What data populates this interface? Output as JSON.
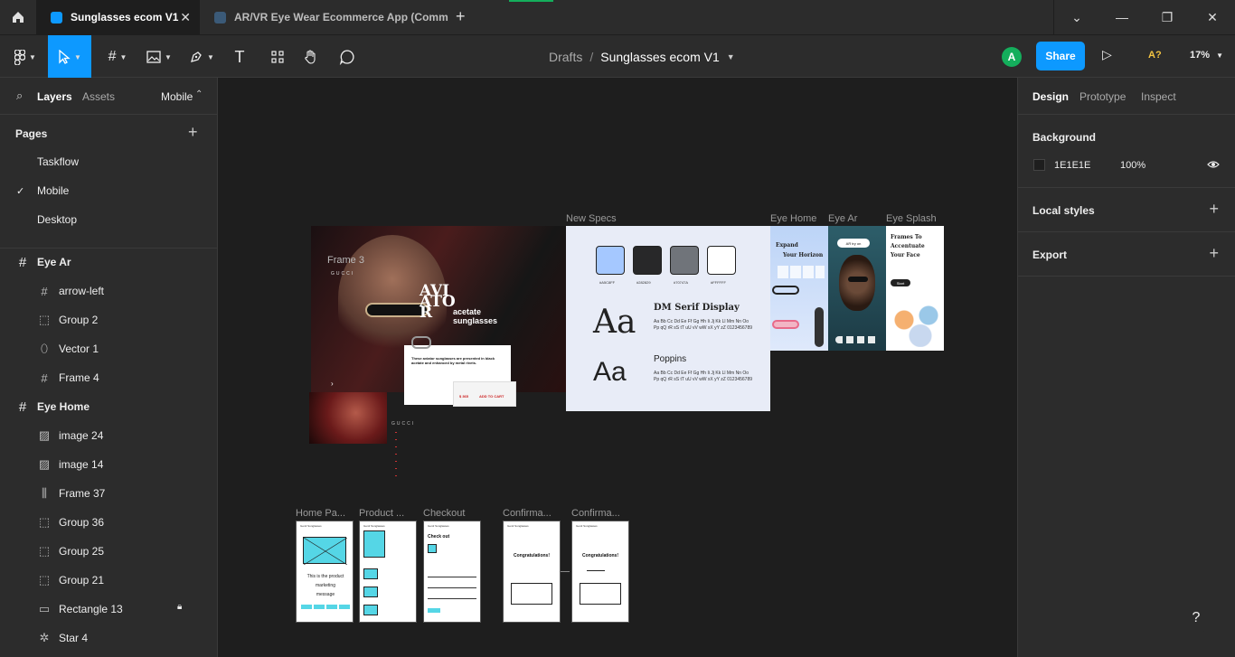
{
  "tabs": {
    "active": {
      "title": "Sunglasses ecom V1"
    },
    "second": {
      "title": "AR/VR Eye Wear Ecommerce App (Comm"
    }
  },
  "window": {
    "minimize": "—",
    "maximize": "❐",
    "close": "✕",
    "menu": "⌄"
  },
  "toolbar": {
    "breadcrumb_parent": "Drafts",
    "breadcrumb_sep": "/",
    "file_name": "Sunglasses ecom V1",
    "avatar_initial": "A",
    "share_label": "Share",
    "a11y_label": "A?",
    "zoom": "17%"
  },
  "left_panel": {
    "tab_layers": "Layers",
    "tab_assets": "Assets",
    "page_selector": "Mobile",
    "pages_title": "Pages",
    "pages": [
      "Taskflow",
      "Mobile",
      "Desktop"
    ],
    "selected_page": "Mobile",
    "layers": [
      {
        "name": "Eye Ar",
        "icon": "frame-icon",
        "level": 0
      },
      {
        "name": "arrow-left",
        "icon": "frame-icon",
        "level": 1
      },
      {
        "name": "Group 2",
        "icon": "group-icon",
        "level": 1
      },
      {
        "name": "Vector 1",
        "icon": "vector-icon",
        "level": 1
      },
      {
        "name": "Frame 4",
        "icon": "frame-icon",
        "level": 1
      },
      {
        "name": "Eye Home",
        "icon": "frame-icon",
        "level": 0
      },
      {
        "name": "image 24",
        "icon": "image-icon",
        "level": 1
      },
      {
        "name": "image 14",
        "icon": "image-icon",
        "level": 1
      },
      {
        "name": "Frame 37",
        "icon": "columns-icon",
        "level": 1
      },
      {
        "name": "Group 36",
        "icon": "group-icon",
        "level": 1
      },
      {
        "name": "Group 25",
        "icon": "group-icon",
        "level": 1
      },
      {
        "name": "Group 21",
        "icon": "group-icon",
        "level": 1
      },
      {
        "name": "Rectangle 13",
        "icon": "rectangle-icon",
        "level": 1,
        "locked": true
      },
      {
        "name": "Star 4",
        "icon": "star-icon",
        "level": 1
      }
    ]
  },
  "canvas": {
    "frame_titles": {
      "new_specs": "New Specs",
      "eye_home": "Eye Home",
      "eye_ar": "Eye Ar",
      "eye_splash": "Eye Splash",
      "frame3": "Frame 3",
      "home_page": "Home Pa...",
      "product": "Product ...",
      "checkout": "Checkout",
      "confirm1": "Confirma...",
      "confirm2": "Confirma..."
    },
    "hero": {
      "brand": "GUCCI",
      "title_line1": "AVI",
      "title_line2": "ATO",
      "title_line3": "R",
      "subtitle_line1": "acetate",
      "subtitle_line2": "sunglasses",
      "card_text": "These aviator sunglasses are presented in black acetate and enhanced by metal rivets.",
      "price": "$ 365",
      "cart": "ADD TO CART"
    },
    "specs": {
      "swatches": [
        "#A5C8FF",
        "#282829",
        "#70747A",
        "#FFFFFF"
      ],
      "swatch_labels": [
        "#A5C8FF",
        "#282829",
        "#70747A",
        "#FFFFFF"
      ],
      "font1_sample": "Aa",
      "font1_name": "DM Serif Display",
      "font1_glyphs": "Aa Bb Cc Dd Ee Ff Gg Hh Ii Jj Kk Ll Mm Nn Oo Pp qQ rR sS tT uU vV wW xX yY zZ 0123456789",
      "font2_sample": "Aa",
      "font2_name": "Poppins",
      "font2_glyphs": "Aa Bb Cc Dd Ee Ff Gg Hh Ii Jj Kk Ll Mm Nn Oo Pp qQ rR sS tT uU vV wW xX yY zZ 0123456789"
    },
    "eye_home": {
      "heading_line1": "Expand",
      "heading_line2": "Your Horizon"
    },
    "eye_ar": {
      "try_on": "AR try on"
    },
    "eye_splash": {
      "heading": "Frames To Accentuate Your Face",
      "start": "Start"
    },
    "wireframes": {
      "home_tagline_line1": "This is the product",
      "home_tagline_line2": "marketing",
      "home_tagline_line3": "message",
      "checkout_title": "Check out",
      "confirm_title": "Congratulations!",
      "brand": "Gen2 Sunglasses"
    }
  },
  "right_panel": {
    "tab_design": "Design",
    "tab_prototype": "Prototype",
    "tab_inspect": "Inspect",
    "background_title": "Background",
    "background_hex": "1E1E1E",
    "background_opacity": "100%",
    "local_styles": "Local styles",
    "export": "Export"
  },
  "help": "?"
}
